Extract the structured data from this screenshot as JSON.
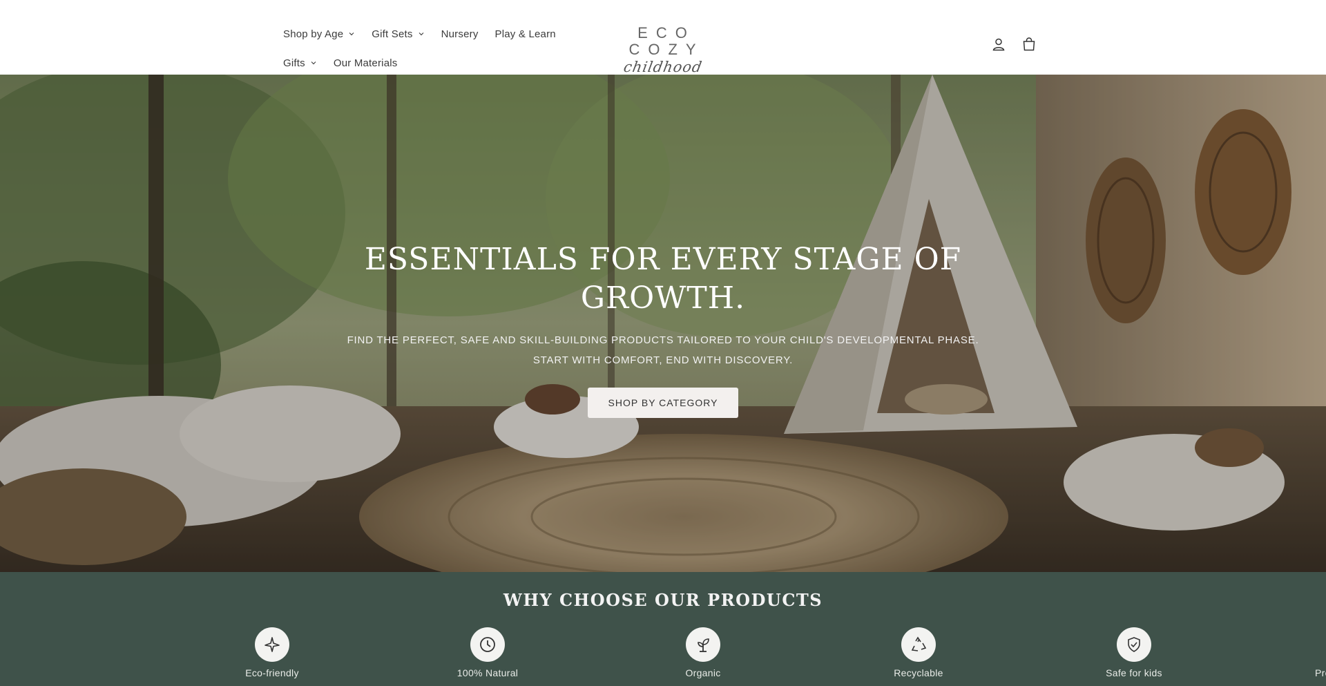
{
  "header": {
    "nav": [
      {
        "label": "Shop by Age",
        "has_dropdown": true
      },
      {
        "label": "Gift Sets",
        "has_dropdown": true
      },
      {
        "label": "Nursery",
        "has_dropdown": false
      },
      {
        "label": "Play & Learn",
        "has_dropdown": false
      },
      {
        "label": "Gifts",
        "has_dropdown": true
      },
      {
        "label": "Our Materials",
        "has_dropdown": false
      }
    ],
    "logo": {
      "top": "ECO COZY",
      "script": "childhood"
    },
    "icons": [
      "account-icon",
      "cart-icon"
    ]
  },
  "hero": {
    "title": "ESSENTIALS FOR EVERY STAGE OF GROWTH.",
    "subtitle_line1": "FIND THE PERFECT, SAFE AND SKILL-BUILDING PRODUCTS TAILORED TO YOUR CHILD'S DEVELOPMENTAL PHASE.",
    "subtitle_line2": "START WITH COMFORT, END WITH DISCOVERY.",
    "button": "SHOP BY CATEGORY"
  },
  "why": {
    "title": "WHY CHOOSE OUR PRODUCTS",
    "features": [
      {
        "label": "Eco-friendly",
        "icon": "airplane-icon"
      },
      {
        "label": "100% Natural",
        "icon": "clock-icon"
      },
      {
        "label": "Organic",
        "icon": "sprout-icon"
      },
      {
        "label": "Recyclable",
        "icon": "recycle-icon"
      },
      {
        "label": "Safe for kids",
        "icon": "shield-check-icon"
      },
      {
        "label": "Pre",
        "icon": "partial-icon"
      }
    ]
  },
  "colors": {
    "header_bg": "#ffffff",
    "why_bg": "#3f524a",
    "button_bg": "#f3f0ee",
    "text": "#333333"
  }
}
